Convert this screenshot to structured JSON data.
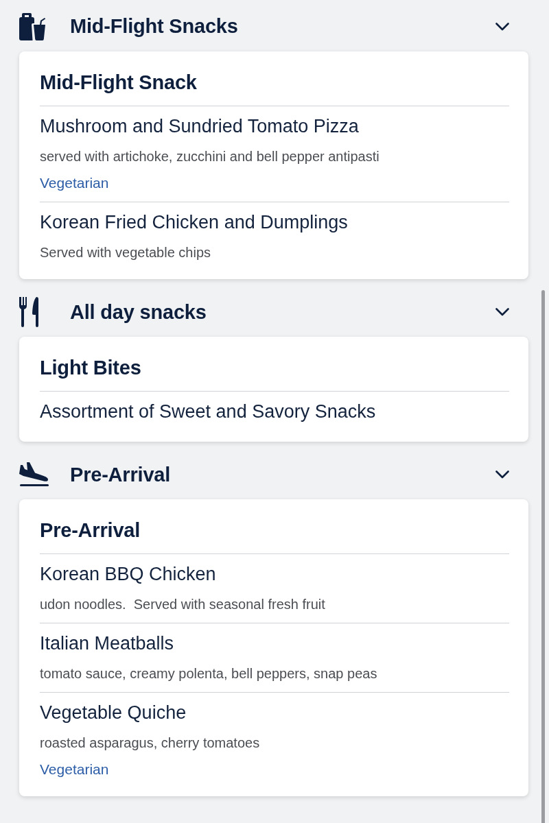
{
  "sections": [
    {
      "kind": "snack",
      "title": "Mid-Flight Snacks",
      "expanded": true,
      "card": {
        "title": "Mid-Flight Snack",
        "items": [
          {
            "name": "Mushroom and Sundried Tomato Pizza",
            "description": "served with artichoke, zucchini and bell pepper antipasti",
            "tag": "Vegetarian"
          },
          {
            "name": "Korean Fried Chicken and Dumplings",
            "description": "Served with vegetable chips"
          }
        ]
      }
    },
    {
      "kind": "meal",
      "title": "All day snacks",
      "expanded": true,
      "card": {
        "title": "Light Bites",
        "items": [
          {
            "name": "Assortment of Sweet and Savory Snacks"
          }
        ]
      }
    },
    {
      "kind": "arrival",
      "title": "Pre-Arrival",
      "expanded": true,
      "card": {
        "title": "Pre-Arrival",
        "items": [
          {
            "name": "Korean BBQ Chicken",
            "description": "udon noodles.  Served with seasonal fresh fruit"
          },
          {
            "name": "Italian Meatballs",
            "description": "tomato sauce, creamy polenta, bell peppers, snap peas"
          },
          {
            "name": "Vegetable Quiche",
            "description": "roasted asparagus, cherry tomatoes",
            "tag": "Vegetarian"
          }
        ]
      }
    }
  ]
}
